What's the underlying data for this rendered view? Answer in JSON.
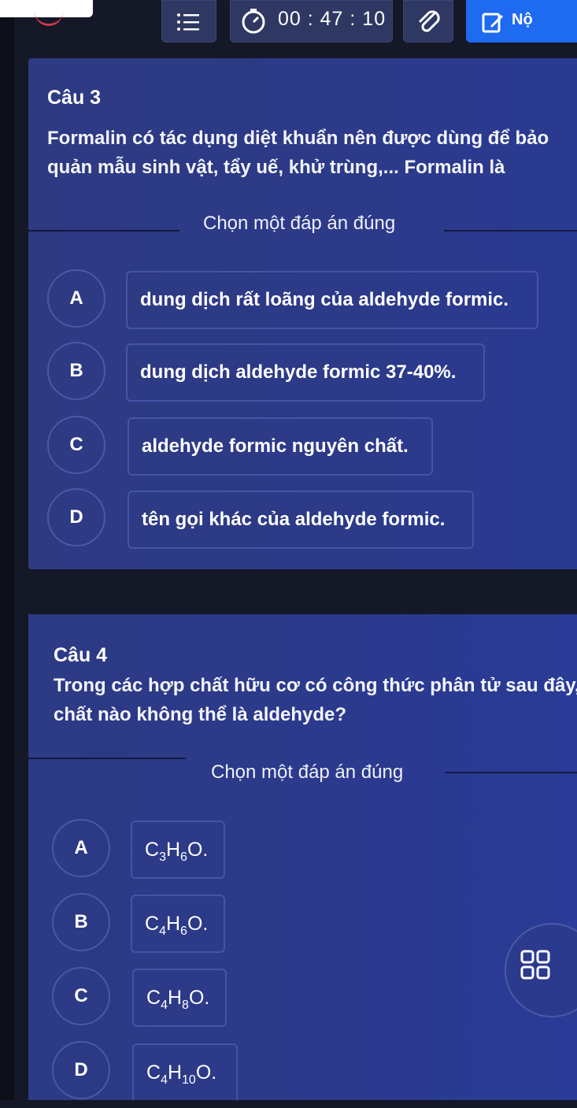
{
  "topbar": {
    "timer": "00 : 47 : 10",
    "submit_label": "Nộ"
  },
  "questions": [
    {
      "title": "Câu 3",
      "text": "Formalin có tác dụng diệt khuẩn nên được dùng để bảo quản mẫu sinh vật, tẩy uế, khử trùng,... Formalin là",
      "choose_label": "Chọn một đáp án đúng",
      "options": [
        {
          "letter": "A",
          "text": "dung dịch rất loãng của aldehyde formic."
        },
        {
          "letter": "B",
          "text": "dung dịch aldehyde formic 37-40%."
        },
        {
          "letter": "C",
          "text": "aldehyde formic nguyên chất."
        },
        {
          "letter": "D",
          "text": "tên gọi khác của aldehyde formic."
        }
      ]
    },
    {
      "title": "Câu 4",
      "text": "Trong các hợp chất hữu cơ có công thức phân tử sau đây, chất nào không thể là aldehyde?",
      "choose_label": "Chọn một đáp án đúng",
      "options": [
        {
          "letter": "A",
          "c": "C",
          "n1": "3",
          "h": "H",
          "n2": "6",
          "o": "O."
        },
        {
          "letter": "B",
          "c": "C",
          "n1": "4",
          "h": "H",
          "n2": "6",
          "o": "O."
        },
        {
          "letter": "C",
          "c": "C",
          "n1": "4",
          "h": "H",
          "n2": "8",
          "o": "O."
        },
        {
          "letter": "D",
          "c": "C",
          "n1": "4",
          "h": "H",
          "n2": "10",
          "o": "O."
        }
      ]
    }
  ],
  "colors": {
    "accent": "#1e6af0",
    "card": "#2a367f",
    "background": "#151826"
  },
  "icons": [
    "list-icon",
    "timer-icon",
    "paperclip-icon",
    "edit-icon",
    "grid-icon"
  ]
}
